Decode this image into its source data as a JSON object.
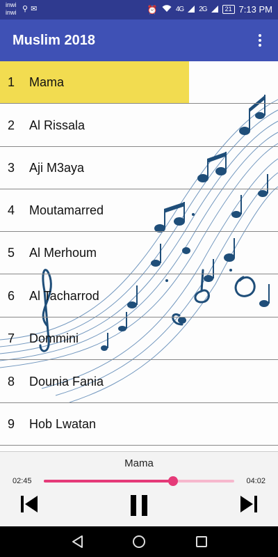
{
  "status_bar": {
    "carrier_1": "inwi",
    "carrier_2": "inwi",
    "signal_1": "4G",
    "signal_2": "2G",
    "battery": "21",
    "time": "7:13 PM",
    "icons": [
      "usb-icon",
      "message-icon",
      "alarm-icon",
      "wifi-icon",
      "signal-icon",
      "battery-icon"
    ]
  },
  "app_bar": {
    "title": "Muslim 2018",
    "menu_icon": "more-vert-icon"
  },
  "tracks": [
    {
      "num": "1",
      "name": "Mama"
    },
    {
      "num": "2",
      "name": "Al Rissala"
    },
    {
      "num": "3",
      "name": "Aji M3aya"
    },
    {
      "num": "4",
      "name": "Moutamarred"
    },
    {
      "num": "5",
      "name": "Al Merhoum"
    },
    {
      "num": "6",
      "name": "Al Tacharrod"
    },
    {
      "num": "7",
      "name": "Dommini"
    },
    {
      "num": "8",
      "name": "Dounia Fania"
    },
    {
      "num": "9",
      "name": "Hob Lwatan"
    }
  ],
  "selected_track_index": 0,
  "player": {
    "now_playing": "Mama",
    "current_time": "02:45",
    "total_time": "04:02",
    "progress": 0.68,
    "controls": [
      "skip-previous-icon",
      "pause-icon",
      "skip-next-icon"
    ]
  },
  "colors": {
    "status_bar": "#2f3a8f",
    "app_bar": "#3f51b5",
    "highlight": "#f2dc50",
    "accent": "#e53a78",
    "music_art": "#1f4e79"
  },
  "nav_bar": {
    "icons": [
      "back-icon",
      "home-icon",
      "recents-icon"
    ]
  }
}
